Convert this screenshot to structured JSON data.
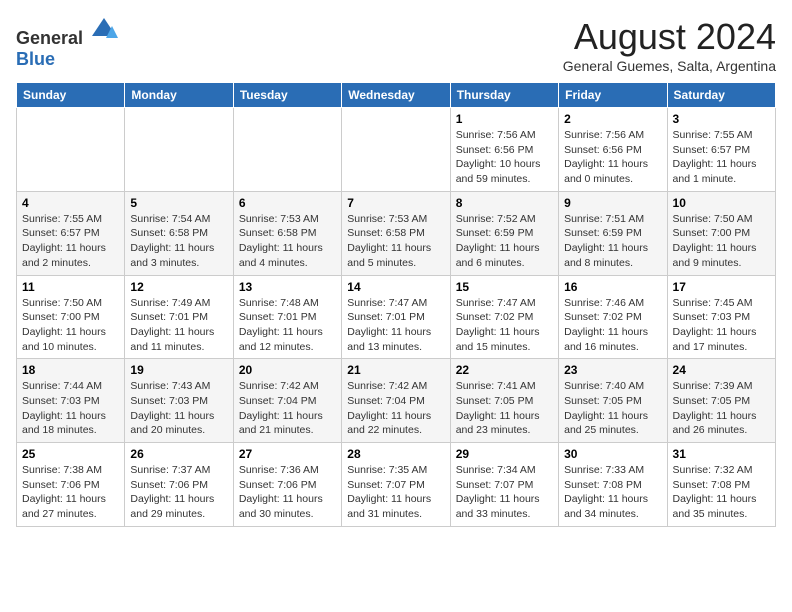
{
  "header": {
    "logo_general": "General",
    "logo_blue": "Blue",
    "month_year": "August 2024",
    "location": "General Guemes, Salta, Argentina"
  },
  "days_of_week": [
    "Sunday",
    "Monday",
    "Tuesday",
    "Wednesday",
    "Thursday",
    "Friday",
    "Saturday"
  ],
  "weeks": [
    [
      {
        "day": "",
        "info": ""
      },
      {
        "day": "",
        "info": ""
      },
      {
        "day": "",
        "info": ""
      },
      {
        "day": "",
        "info": ""
      },
      {
        "day": "1",
        "info": "Sunrise: 7:56 AM\nSunset: 6:56 PM\nDaylight: 10 hours\nand 59 minutes."
      },
      {
        "day": "2",
        "info": "Sunrise: 7:56 AM\nSunset: 6:56 PM\nDaylight: 11 hours\nand 0 minutes."
      },
      {
        "day": "3",
        "info": "Sunrise: 7:55 AM\nSunset: 6:57 PM\nDaylight: 11 hours\nand 1 minute."
      }
    ],
    [
      {
        "day": "4",
        "info": "Sunrise: 7:55 AM\nSunset: 6:57 PM\nDaylight: 11 hours\nand 2 minutes."
      },
      {
        "day": "5",
        "info": "Sunrise: 7:54 AM\nSunset: 6:58 PM\nDaylight: 11 hours\nand 3 minutes."
      },
      {
        "day": "6",
        "info": "Sunrise: 7:53 AM\nSunset: 6:58 PM\nDaylight: 11 hours\nand 4 minutes."
      },
      {
        "day": "7",
        "info": "Sunrise: 7:53 AM\nSunset: 6:58 PM\nDaylight: 11 hours\nand 5 minutes."
      },
      {
        "day": "8",
        "info": "Sunrise: 7:52 AM\nSunset: 6:59 PM\nDaylight: 11 hours\nand 6 minutes."
      },
      {
        "day": "9",
        "info": "Sunrise: 7:51 AM\nSunset: 6:59 PM\nDaylight: 11 hours\nand 8 minutes."
      },
      {
        "day": "10",
        "info": "Sunrise: 7:50 AM\nSunset: 7:00 PM\nDaylight: 11 hours\nand 9 minutes."
      }
    ],
    [
      {
        "day": "11",
        "info": "Sunrise: 7:50 AM\nSunset: 7:00 PM\nDaylight: 11 hours\nand 10 minutes."
      },
      {
        "day": "12",
        "info": "Sunrise: 7:49 AM\nSunset: 7:01 PM\nDaylight: 11 hours\nand 11 minutes."
      },
      {
        "day": "13",
        "info": "Sunrise: 7:48 AM\nSunset: 7:01 PM\nDaylight: 11 hours\nand 12 minutes."
      },
      {
        "day": "14",
        "info": "Sunrise: 7:47 AM\nSunset: 7:01 PM\nDaylight: 11 hours\nand 13 minutes."
      },
      {
        "day": "15",
        "info": "Sunrise: 7:47 AM\nSunset: 7:02 PM\nDaylight: 11 hours\nand 15 minutes."
      },
      {
        "day": "16",
        "info": "Sunrise: 7:46 AM\nSunset: 7:02 PM\nDaylight: 11 hours\nand 16 minutes."
      },
      {
        "day": "17",
        "info": "Sunrise: 7:45 AM\nSunset: 7:03 PM\nDaylight: 11 hours\nand 17 minutes."
      }
    ],
    [
      {
        "day": "18",
        "info": "Sunrise: 7:44 AM\nSunset: 7:03 PM\nDaylight: 11 hours\nand 18 minutes."
      },
      {
        "day": "19",
        "info": "Sunrise: 7:43 AM\nSunset: 7:03 PM\nDaylight: 11 hours\nand 20 minutes."
      },
      {
        "day": "20",
        "info": "Sunrise: 7:42 AM\nSunset: 7:04 PM\nDaylight: 11 hours\nand 21 minutes."
      },
      {
        "day": "21",
        "info": "Sunrise: 7:42 AM\nSunset: 7:04 PM\nDaylight: 11 hours\nand 22 minutes."
      },
      {
        "day": "22",
        "info": "Sunrise: 7:41 AM\nSunset: 7:05 PM\nDaylight: 11 hours\nand 23 minutes."
      },
      {
        "day": "23",
        "info": "Sunrise: 7:40 AM\nSunset: 7:05 PM\nDaylight: 11 hours\nand 25 minutes."
      },
      {
        "day": "24",
        "info": "Sunrise: 7:39 AM\nSunset: 7:05 PM\nDaylight: 11 hours\nand 26 minutes."
      }
    ],
    [
      {
        "day": "25",
        "info": "Sunrise: 7:38 AM\nSunset: 7:06 PM\nDaylight: 11 hours\nand 27 minutes."
      },
      {
        "day": "26",
        "info": "Sunrise: 7:37 AM\nSunset: 7:06 PM\nDaylight: 11 hours\nand 29 minutes."
      },
      {
        "day": "27",
        "info": "Sunrise: 7:36 AM\nSunset: 7:06 PM\nDaylight: 11 hours\nand 30 minutes."
      },
      {
        "day": "28",
        "info": "Sunrise: 7:35 AM\nSunset: 7:07 PM\nDaylight: 11 hours\nand 31 minutes."
      },
      {
        "day": "29",
        "info": "Sunrise: 7:34 AM\nSunset: 7:07 PM\nDaylight: 11 hours\nand 33 minutes."
      },
      {
        "day": "30",
        "info": "Sunrise: 7:33 AM\nSunset: 7:08 PM\nDaylight: 11 hours\nand 34 minutes."
      },
      {
        "day": "31",
        "info": "Sunrise: 7:32 AM\nSunset: 7:08 PM\nDaylight: 11 hours\nand 35 minutes."
      }
    ]
  ]
}
